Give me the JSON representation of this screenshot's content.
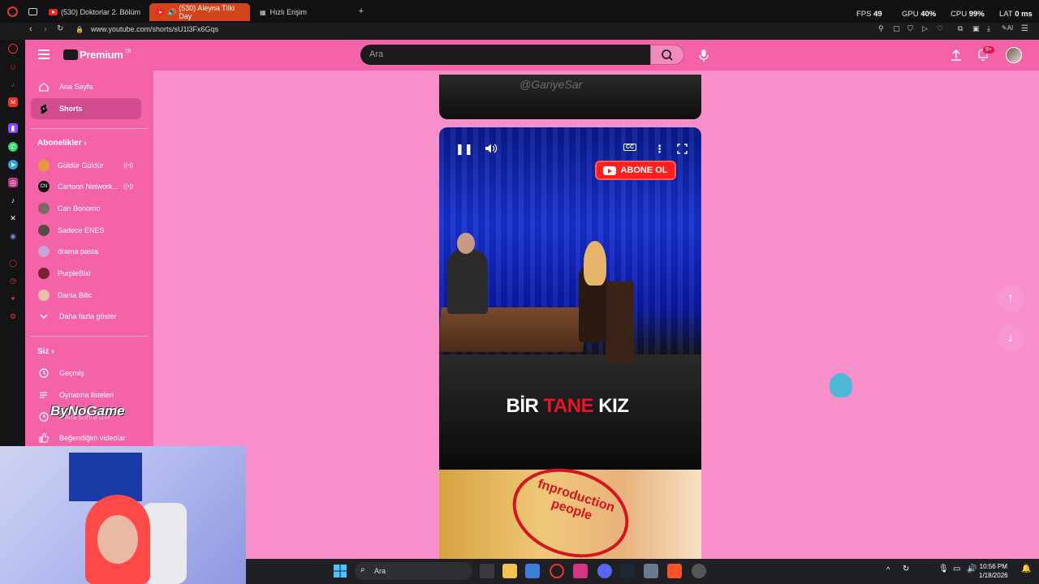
{
  "browser": {
    "tabs": [
      {
        "label": "(530) Doktorlar 2. Bölüm"
      },
      {
        "label": "(530) Aleyna Tilki Day"
      },
      {
        "label": "Hızlı Erişim"
      }
    ],
    "url": "www.youtube.com/shorts/sU1l3Fx6Gqs",
    "stats": {
      "fps_label": "FPS",
      "fps_value": "49",
      "gpu_label": "GPU",
      "gpu_value": "40%",
      "cpu_label": "CPU",
      "cpu_value": "99%",
      "lat_label": "LAT",
      "lat_value": "0 ms"
    }
  },
  "youtube": {
    "logo_text": "Premium",
    "logo_region": "TR",
    "search_placeholder": "Ara",
    "notifications_badge": "9+",
    "nav": {
      "home": "Ana Sayfa",
      "shorts": "Shorts",
      "subs_header": "Abonelikler",
      "subscriptions": [
        {
          "label": "Güldür Güldür",
          "live": "((•))",
          "color": "#e39b3b"
        },
        {
          "label": "Cartoon Network...",
          "live": "((•))",
          "color": "#111111"
        },
        {
          "label": "Can Bonomo",
          "live": "",
          "color": "#7d6a60"
        },
        {
          "label": "Sadece ENES",
          "live": "",
          "color": "#5a4a44"
        },
        {
          "label": "drama pasta",
          "live": "",
          "color": "#c7a3d6"
        },
        {
          "label": "PurpleBixi",
          "live": "",
          "color": "#7a2233"
        },
        {
          "label": "Dania Bilic",
          "live": "",
          "color": "#e3c0a6"
        }
      ],
      "show_more": "Daha fazla göster",
      "you_header": "Siz",
      "history": "Geçmiş",
      "playlists": "Oynatma listeleri",
      "watch_later": "Daha sonra izle",
      "liked": "Beğendiğim videolar"
    },
    "short": {
      "subscribe_label": "ABONE OL",
      "caption_pre": "BİR ",
      "caption_red": "TANE",
      "caption_post": " KIZ",
      "prev_watermark": "@GariyeSar",
      "next_stamp": "fnproduction people"
    }
  },
  "overlay": {
    "brand": "ByNoGame"
  },
  "taskbar": {
    "search_placeholder": "Ara",
    "time": "10:56 PM",
    "date": "1/18/2026"
  },
  "colors": {
    "accent_pink": "#f462a8",
    "main_bg": "#f78fca",
    "subscribe_red": "#ff1e1e"
  }
}
